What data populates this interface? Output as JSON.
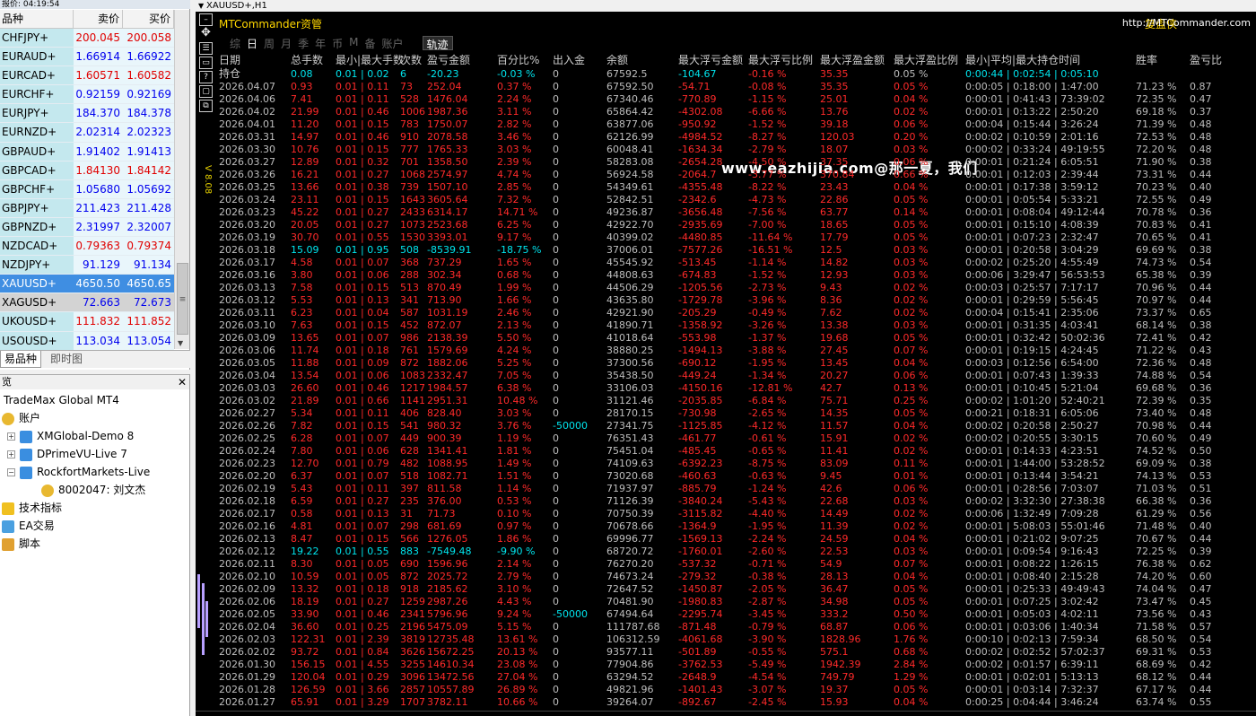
{
  "market_watch": {
    "title": "报价: 04:19:54",
    "col_symbol": "品种",
    "col_bid": "卖价",
    "col_ask": "买价",
    "rows": [
      {
        "symbol": "CHFJPY+",
        "bid": "200.045",
        "ask": "200.058",
        "dir": "down"
      },
      {
        "symbol": "EURAUD+",
        "bid": "1.66914",
        "ask": "1.66922",
        "dir": "up"
      },
      {
        "symbol": "EURCAD+",
        "bid": "1.60571",
        "ask": "1.60582",
        "dir": "down"
      },
      {
        "symbol": "EURCHF+",
        "bid": "0.92159",
        "ask": "0.92169",
        "dir": "up"
      },
      {
        "symbol": "EURJPY+",
        "bid": "184.370",
        "ask": "184.378",
        "dir": "up"
      },
      {
        "symbol": "EURNZD+",
        "bid": "2.02314",
        "ask": "2.02323",
        "dir": "up"
      },
      {
        "symbol": "GBPAUD+",
        "bid": "1.91402",
        "ask": "1.91413",
        "dir": "up"
      },
      {
        "symbol": "GBPCAD+",
        "bid": "1.84130",
        "ask": "1.84142",
        "dir": "down"
      },
      {
        "symbol": "GBPCHF+",
        "bid": "1.05680",
        "ask": "1.05692",
        "dir": "up"
      },
      {
        "symbol": "GBPJPY+",
        "bid": "211.423",
        "ask": "211.428",
        "dir": "up"
      },
      {
        "symbol": "GBPNZD+",
        "bid": "2.31997",
        "ask": "2.32007",
        "dir": "up"
      },
      {
        "symbol": "NZDCAD+",
        "bid": "0.79363",
        "ask": "0.79374",
        "dir": "down"
      },
      {
        "symbol": "NZDJPY+",
        "bid": "91.129",
        "ask": "91.134",
        "dir": "up"
      },
      {
        "symbol": "XAUUSD+",
        "bid": "4650.50",
        "ask": "4650.65",
        "dir": "sel"
      },
      {
        "symbol": "XAGUSD+",
        "bid": "72.663",
        "ask": "72.673",
        "dir": "alt"
      },
      {
        "symbol": "UKOUSD+",
        "bid": "111.832",
        "ask": "111.852",
        "dir": "down"
      },
      {
        "symbol": "USOUSD+",
        "bid": "113.034",
        "ask": "113.054",
        "dir": "up"
      }
    ],
    "tab_symbols": "易品种",
    "tab_chart": "即时图"
  },
  "navigator": {
    "title": "览",
    "root": "TradeMax Global MT4",
    "accounts": "账户",
    "acc1": "XMGlobal-Demo 8",
    "acc2": "DPrimeVU-Live 7",
    "acc3": "RockfortMarkets-Live",
    "acc3_user": "8002047: 刘文杰",
    "indicators": "技术指标",
    "ea": "EA交易",
    "scripts": "脚本"
  },
  "chart": {
    "title": "XAUUSD+,H1",
    "vertical_label": "V 8.08",
    "app_title": "MTCommander资管",
    "fupan": "复盘侠",
    "url": "http://MTCommander.com",
    "tabs": [
      "综",
      "日",
      "周",
      "月",
      "季",
      "年",
      "币",
      "M",
      "备",
      "账户"
    ],
    "track": "轨迹",
    "watermark": "www.eazhijia.com@那一夏，我们",
    "headers": [
      "日期",
      "总手数",
      "最小|最大手数",
      "次数",
      "盈亏金额",
      "百分比%",
      "出入金",
      "余额",
      "最大浮亏金额",
      "最大浮亏比例",
      "最大浮盈金额",
      "最大浮盈比例",
      "最小|平均|最大持仓时间",
      "胜率",
      "盈亏比"
    ],
    "hold_label": "持仓",
    "hold_row": [
      "0.08",
      "0.01 | 0.02",
      "6",
      "-20.23",
      "-0.03 %",
      "0",
      "67592.5",
      "-104.67",
      "-0.16 %",
      "35.35",
      "0.05 %",
      "0:00:44 | 0:02:54 | 0:05:10",
      "",
      ""
    ],
    "rows": [
      [
        "2026.04.07",
        "0.93",
        "0.01 | 0.11",
        "73",
        "252.04",
        "0.37 %",
        "0",
        "67592.50",
        "-54.71",
        "-0.08 %",
        "35.35",
        "0.05 %",
        "0:00:05 | 0:18:00 | 1:47:00",
        "71.23 %",
        "0.87"
      ],
      [
        "2026.04.06",
        "7.41",
        "0.01 | 0.11",
        "528",
        "1476.04",
        "2.24 %",
        "0",
        "67340.46",
        "-770.89",
        "-1.15 %",
        "25.01",
        "0.04 %",
        "0:00:01 | 0:41:43 | 73:39:02",
        "72.35 %",
        "0.47"
      ],
      [
        "2026.04.02",
        "21.99",
        "0.01 | 0.46",
        "1006",
        "1987.36",
        "3.11 %",
        "0",
        "65864.42",
        "-4302.08",
        "-6.66 %",
        "13.76",
        "0.02 %",
        "0:00:01 | 0:13:22 | 2:50:20",
        "69.18 %",
        "0.37"
      ],
      [
        "2026.04.01",
        "11.20",
        "0.01 | 0.15",
        "783",
        "1750.07",
        "2.82 %",
        "0",
        "63877.06",
        "-950.92",
        "-1.52 %",
        "39.18",
        "0.06 %",
        "0:00:04 | 0:15:44 | 3:26:24",
        "71.39 %",
        "0.48"
      ],
      [
        "2026.03.31",
        "14.97",
        "0.01 | 0.46",
        "910",
        "2078.58",
        "3.46 %",
        "0",
        "62126.99",
        "-4984.52",
        "-8.27 %",
        "120.03",
        "0.20 %",
        "0:00:02 | 0:10:59 | 2:01:16",
        "72.53 %",
        "0.48"
      ],
      [
        "2026.03.30",
        "10.76",
        "0.01 | 0.15",
        "777",
        "1765.33",
        "3.03 %",
        "0",
        "60048.41",
        "-1634.34",
        "-2.79 %",
        "18.07",
        "0.03 %",
        "0:00:02 | 0:33:24 | 49:19:55",
        "72.20 %",
        "0.48"
      ],
      [
        "2026.03.27",
        "12.89",
        "0.01 | 0.32",
        "701",
        "1358.50",
        "2.39 %",
        "0",
        "58283.08",
        "-2654.28",
        "-4.50 %",
        "37.35",
        "0.06 %",
        "0:00:01 | 0:21:24 | 6:05:51",
        "71.90 %",
        "0.38"
      ],
      [
        "2026.03.26",
        "16.21",
        "0.01 | 0.27",
        "1068",
        "2574.97",
        "4.74 %",
        "0",
        "56924.58",
        "-2064.7",
        "-3.77 %",
        "370.84",
        "0.66 %",
        "0:00:01 | 0:12:03 | 2:39:44",
        "73.31 %",
        "0.44"
      ],
      [
        "2026.03.25",
        "13.66",
        "0.01 | 0.38",
        "739",
        "1507.10",
        "2.85 %",
        "0",
        "54349.61",
        "-4355.48",
        "-8.22 %",
        "23.43",
        "0.04 %",
        "0:00:01 | 0:17:38 | 3:59:12",
        "70.23 %",
        "0.40"
      ],
      [
        "2026.03.24",
        "23.11",
        "0.01 | 0.15",
        "1643",
        "3605.64",
        "7.32 %",
        "0",
        "52842.51",
        "-2342.6",
        "-4.73 %",
        "22.86",
        "0.05 %",
        "0:00:01 | 0:05:54 | 5:33:21",
        "72.55 %",
        "0.49"
      ],
      [
        "2026.03.23",
        "45.22",
        "0.01 | 0.27",
        "2433",
        "6314.17",
        "14.71 %",
        "0",
        "49236.87",
        "-3656.48",
        "-7.56 %",
        "63.77",
        "0.14 %",
        "0:00:01 | 0:08:04 | 49:12:44",
        "70.78 %",
        "0.36"
      ],
      [
        "2026.03.20",
        "20.05",
        "0.01 | 0.27",
        "1073",
        "2523.68",
        "6.25 %",
        "0",
        "42922.70",
        "-2935.69",
        "-7.00 %",
        "18.65",
        "0.05 %",
        "0:00:01 | 0:15:10 | 4:08:39",
        "70.83 %",
        "0.41"
      ],
      [
        "2026.03.19",
        "30.70",
        "0.01 | 0.55",
        "1530",
        "3393.01",
        "9.17 %",
        "0",
        "40399.02",
        "-4480.85",
        "-11.64 %",
        "17.79",
        "0.05 %",
        "0:00:01 | 0:07:23 | 2:32:47",
        "70.65 %",
        "0.41"
      ],
      [
        "2026.03.18",
        "15.09",
        "0.01 | 0.95",
        "508",
        "-8539.91",
        "-18.75 %",
        "0",
        "37006.01",
        "-7577.26",
        "-16.51 %",
        "12.5",
        "0.03 %",
        "0:00:01 | 0:20:58 | 3:04:29",
        "69.69 %",
        "0.38"
      ],
      [
        "2026.03.17",
        "4.58",
        "0.01 | 0.07",
        "368",
        "737.29",
        "1.65 %",
        "0",
        "45545.92",
        "-513.45",
        "-1.14 %",
        "14.82",
        "0.03 %",
        "0:00:02 | 0:25:20 | 4:55:49",
        "74.73 %",
        "0.54"
      ],
      [
        "2026.03.16",
        "3.80",
        "0.01 | 0.06",
        "288",
        "302.34",
        "0.68 %",
        "0",
        "44808.63",
        "-674.83",
        "-1.52 %",
        "12.93",
        "0.03 %",
        "0:00:06 | 3:29:47 | 56:53:53",
        "65.38 %",
        "0.39"
      ],
      [
        "2026.03.13",
        "7.58",
        "0.01 | 0.15",
        "513",
        "870.49",
        "1.99 %",
        "0",
        "44506.29",
        "-1205.56",
        "-2.73 %",
        "9.43",
        "0.02 %",
        "0:00:03 | 0:25:57 | 7:17:17",
        "70.96 %",
        "0.44"
      ],
      [
        "2026.03.12",
        "5.53",
        "0.01 | 0.13",
        "341",
        "713.90",
        "1.66 %",
        "0",
        "43635.80",
        "-1729.78",
        "-3.96 %",
        "8.36",
        "0.02 %",
        "0:00:01 | 0:29:59 | 5:56:45",
        "70.97 %",
        "0.44"
      ],
      [
        "2026.03.11",
        "6.23",
        "0.01 | 0.04",
        "587",
        "1031.19",
        "2.46 %",
        "0",
        "42921.90",
        "-205.29",
        "-0.49 %",
        "7.62",
        "0.02 %",
        "0:00:04 | 0:15:41 | 2:35:06",
        "73.37 %",
        "0.65"
      ],
      [
        "2026.03.10",
        "7.63",
        "0.01 | 0.15",
        "452",
        "872.07",
        "2.13 %",
        "0",
        "41890.71",
        "-1358.92",
        "-3.26 %",
        "13.38",
        "0.03 %",
        "0:00:01 | 0:31:35 | 4:03:41",
        "68.14 %",
        "0.38"
      ],
      [
        "2026.03.09",
        "13.65",
        "0.01 | 0.07",
        "986",
        "2138.39",
        "5.50 %",
        "0",
        "41018.64",
        "-553.98",
        "-1.37 %",
        "19.68",
        "0.05 %",
        "0:00:01 | 0:32:42 | 50:02:36",
        "72.41 %",
        "0.42"
      ],
      [
        "2026.03.06",
        "11.74",
        "0.01 | 0.18",
        "761",
        "1579.69",
        "4.24 %",
        "0",
        "38880.25",
        "-1494.13",
        "-3.88 %",
        "27.45",
        "0.07 %",
        "0:00:01 | 0:19:15 | 4:24:45",
        "71.22 %",
        "0.43"
      ],
      [
        "2026.03.05",
        "11.88",
        "0.01 | 0.09",
        "872",
        "1882.06",
        "5.25 %",
        "0",
        "37300.56",
        "-690.12",
        "-1.95 %",
        "13.45",
        "0.04 %",
        "0:00:03 | 0:12:56 | 6:54:00",
        "72.36 %",
        "0.48"
      ],
      [
        "2026.03.04",
        "13.54",
        "0.01 | 0.06",
        "1083",
        "2332.47",
        "7.05 %",
        "0",
        "35438.50",
        "-449.24",
        "-1.34 %",
        "20.27",
        "0.06 %",
        "0:00:01 | 0:07:43 | 1:39:33",
        "74.88 %",
        "0.54"
      ],
      [
        "2026.03.03",
        "26.60",
        "0.01 | 0.46",
        "1217",
        "1984.57",
        "6.38 %",
        "0",
        "33106.03",
        "-4150.16",
        "-12.81 %",
        "42.7",
        "0.13 %",
        "0:00:01 | 0:10:45 | 5:21:04",
        "69.68 %",
        "0.36"
      ],
      [
        "2026.03.02",
        "21.89",
        "0.01 | 0.66",
        "1141",
        "2951.31",
        "10.48 %",
        "0",
        "31121.46",
        "-2035.85",
        "-6.84 %",
        "75.71",
        "0.25 %",
        "0:00:02 | 1:01:20 | 52:40:21",
        "72.39 %",
        "0.35"
      ],
      [
        "2026.02.27",
        "5.34",
        "0.01 | 0.11",
        "406",
        "828.40",
        "3.03 %",
        "0",
        "28170.15",
        "-730.98",
        "-2.65 %",
        "14.35",
        "0.05 %",
        "0:00:21 | 0:18:31 | 6:05:06",
        "73.40 %",
        "0.48"
      ],
      [
        "2026.02.26",
        "7.82",
        "0.01 | 0.15",
        "541",
        "980.32",
        "3.76 %",
        "-50000",
        "27341.75",
        "-1125.85",
        "-4.12 %",
        "11.57",
        "0.04 %",
        "0:00:02 | 0:20:58 | 2:50:27",
        "70.98 %",
        "0.44"
      ],
      [
        "2026.02.25",
        "6.28",
        "0.01 | 0.07",
        "449",
        "900.39",
        "1.19 %",
        "0",
        "76351.43",
        "-461.77",
        "-0.61 %",
        "15.91",
        "0.02 %",
        "0:00:02 | 0:20:55 | 3:30:15",
        "70.60 %",
        "0.49"
      ],
      [
        "2026.02.24",
        "7.80",
        "0.01 | 0.06",
        "628",
        "1341.41",
        "1.81 %",
        "0",
        "75451.04",
        "-485.45",
        "-0.65 %",
        "11.41",
        "0.02 %",
        "0:00:01 | 0:14:33 | 4:23:51",
        "74.52 %",
        "0.50"
      ],
      [
        "2026.02.23",
        "12.70",
        "0.01 | 0.79",
        "482",
        "1088.95",
        "1.49 %",
        "0",
        "74109.63",
        "-6392.23",
        "-8.75 %",
        "83.09",
        "0.11 %",
        "0:00:01 | 1:44:00 | 53:28:52",
        "69.09 %",
        "0.38"
      ],
      [
        "2026.02.20",
        "6.37",
        "0.01 | 0.07",
        "518",
        "1082.71",
        "1.51 %",
        "0",
        "73020.68",
        "-460.63",
        "-0.63 %",
        "9.45",
        "0.01 %",
        "0:00:01 | 0:13:44 | 3:54:21",
        "74.13 %",
        "0.53"
      ],
      [
        "2026.02.19",
        "5.43",
        "0.01 | 0.11",
        "397",
        "811.58",
        "1.14 %",
        "0",
        "71937.97",
        "-885.79",
        "-1.24 %",
        "42.6",
        "0.06 %",
        "0:00:01 | 0:28:56 | 7:03:07",
        "71.03 %",
        "0.51"
      ],
      [
        "2026.02.18",
        "6.59",
        "0.01 | 0.27",
        "235",
        "376.00",
        "0.53 %",
        "0",
        "71126.39",
        "-3840.24",
        "-5.43 %",
        "22.68",
        "0.03 %",
        "0:00:02 | 3:32:30 | 27:38:38",
        "66.38 %",
        "0.36"
      ],
      [
        "2026.02.17",
        "0.58",
        "0.01 | 0.13",
        "31",
        "71.73",
        "0.10 %",
        "0",
        "70750.39",
        "-3115.82",
        "-4.40 %",
        "14.49",
        "0.02 %",
        "0:00:06 | 1:32:49 | 7:09:28",
        "61.29 %",
        "0.56"
      ],
      [
        "2026.02.16",
        "4.81",
        "0.01 | 0.07",
        "298",
        "681.69",
        "0.97 %",
        "0",
        "70678.66",
        "-1364.9",
        "-1.95 %",
        "11.39",
        "0.02 %",
        "0:00:01 | 5:08:03 | 55:01:46",
        "71.48 %",
        "0.40"
      ],
      [
        "2026.02.13",
        "8.47",
        "0.01 | 0.15",
        "566",
        "1276.05",
        "1.86 %",
        "0",
        "69996.77",
        "-1569.13",
        "-2.24 %",
        "24.59",
        "0.04 %",
        "0:00:01 | 0:21:02 | 9:07:25",
        "70.67 %",
        "0.44"
      ],
      [
        "2026.02.12",
        "19.22",
        "0.01 | 0.55",
        "883",
        "-7549.48",
        "-9.90 %",
        "0",
        "68720.72",
        "-1760.01",
        "-2.60 %",
        "22.53",
        "0.03 %",
        "0:00:01 | 0:09:54 | 9:16:43",
        "72.25 %",
        "0.39"
      ],
      [
        "2026.02.11",
        "8.30",
        "0.01 | 0.05",
        "690",
        "1596.96",
        "2.14 %",
        "0",
        "76270.20",
        "-537.32",
        "-0.71 %",
        "54.9",
        "0.07 %",
        "0:00:01 | 0:08:22 | 1:26:15",
        "76.38 %",
        "0.62"
      ],
      [
        "2026.02.10",
        "10.59",
        "0.01 | 0.05",
        "872",
        "2025.72",
        "2.79 %",
        "0",
        "74673.24",
        "-279.32",
        "-0.38 %",
        "28.13",
        "0.04 %",
        "0:00:01 | 0:08:40 | 2:15:28",
        "74.20 %",
        "0.60"
      ],
      [
        "2026.02.09",
        "13.32",
        "0.01 | 0.18",
        "918",
        "2185.62",
        "3.10 %",
        "0",
        "72647.52",
        "-1450.87",
        "-2.05 %",
        "36.47",
        "0.05 %",
        "0:00:01 | 0:25:33 | 49:49:43",
        "74.04 %",
        "0.47"
      ],
      [
        "2026.02.06",
        "18.19",
        "0.01 | 0.27",
        "1259",
        "2987.26",
        "4.43 %",
        "0",
        "70481.90",
        "-1980.83",
        "-2.87 %",
        "34.98",
        "0.05 %",
        "0:00:01 | 0:07:25 | 3:02:42",
        "73.47 %",
        "0.45"
      ],
      [
        "2026.02.05",
        "33.90",
        "0.01 | 0.46",
        "2341",
        "5796.96",
        "9.24 %",
        "-50000",
        "67494.64",
        "-2295.74",
        "-3.45 %",
        "333.2",
        "0.50 %",
        "0:00:01 | 0:05:03 | 4:02:11",
        "73.56 %",
        "0.43"
      ],
      [
        "2026.02.04",
        "36.60",
        "0.01 | 0.25",
        "2196",
        "5475.09",
        "5.15 %",
        "0",
        "111787.68",
        "-871.48",
        "-0.79 %",
        "68.87",
        "0.06 %",
        "0:00:01 | 0:03:06 | 1:40:34",
        "71.58 %",
        "0.57"
      ],
      [
        "2026.02.03",
        "122.31",
        "0.01 | 2.39",
        "3819",
        "12735.48",
        "13.61 %",
        "0",
        "106312.59",
        "-4061.68",
        "-3.90 %",
        "1828.96",
        "1.76 %",
        "0:00:10 | 0:02:13 | 7:59:34",
        "68.50 %",
        "0.54"
      ],
      [
        "2026.02.02",
        "93.72",
        "0.01 | 0.84",
        "3626",
        "15672.25",
        "20.13 %",
        "0",
        "93577.11",
        "-501.89",
        "-0.55 %",
        "575.1",
        "0.68 %",
        "0:00:02 | 0:02:52 | 57:02:37",
        "69.31 %",
        "0.53"
      ],
      [
        "2026.01.30",
        "156.15",
        "0.01 | 4.55",
        "3255",
        "14610.34",
        "23.08 %",
        "0",
        "77904.86",
        "-3762.53",
        "-5.49 %",
        "1942.39",
        "2.84 %",
        "0:00:02 | 0:01:57 | 6:39:11",
        "68.69 %",
        "0.42"
      ],
      [
        "2026.01.29",
        "120.04",
        "0.01 | 0.29",
        "3096",
        "13472.56",
        "27.04 %",
        "0",
        "63294.52",
        "-2648.9",
        "-4.54 %",
        "749.79",
        "1.29 %",
        "0:00:01 | 0:02:01 | 5:13:13",
        "68.12 %",
        "0.44"
      ],
      [
        "2026.01.28",
        "126.59",
        "0.01 | 3.66",
        "2857",
        "10557.89",
        "26.89 %",
        "0",
        "49821.96",
        "-1401.43",
        "-3.07 %",
        "19.37",
        "0.05 %",
        "0:00:01 | 0:03:14 | 7:32:37",
        "67.17 %",
        "0.44"
      ],
      [
        "2026.01.27",
        "65.91",
        "0.01 | 3.29",
        "1707",
        "3782.11",
        "10.66 %",
        "0",
        "39264.07",
        "-892.67",
        "-2.45 %",
        "15.93",
        "0.04 %",
        "0:00:25 | 0:04:44 | 3:46:24",
        "63.74 %",
        "0.55"
      ]
    ],
    "colors": {
      "red": "#ff2a2a",
      "cyan": "#00e5ee",
      "gray": "#bdbdbd",
      "header": "#cccccc"
    }
  }
}
